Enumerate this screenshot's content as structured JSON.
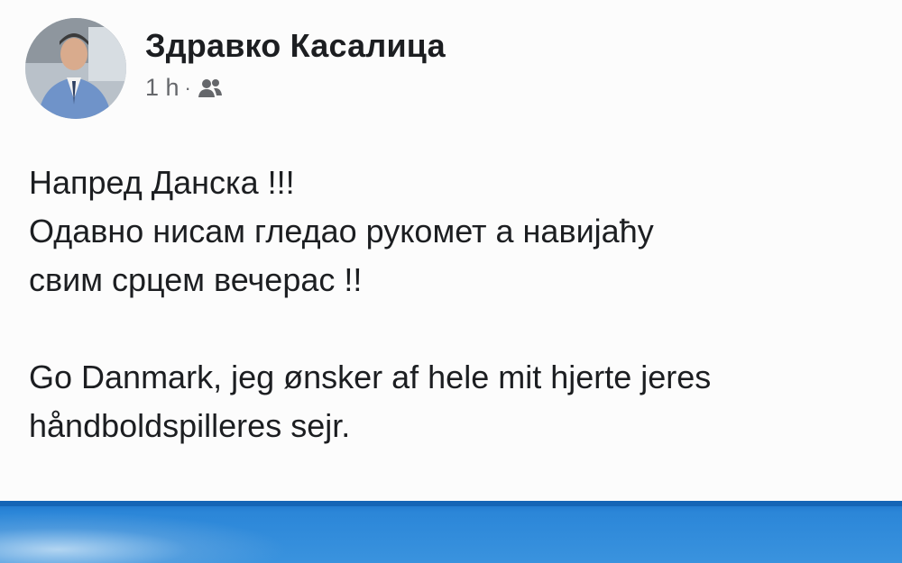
{
  "post": {
    "author_name": "Здравко Касалица",
    "timestamp": "1 h",
    "separator": "·",
    "audience_icon": "friends-icon",
    "text_lines": [
      "Напред Данска !!!",
      "Одавно нисам гледао рукомет а навијаћу",
      "свим срцем вечерас !!",
      "",
      "Go Danmark, jeg ønsker af hele mit hjerte jeres",
      "håndboldspilleres sejr."
    ]
  },
  "colors": {
    "name": "#1c1e21",
    "meta": "#65676b",
    "image_blue": "#2b86d8"
  }
}
